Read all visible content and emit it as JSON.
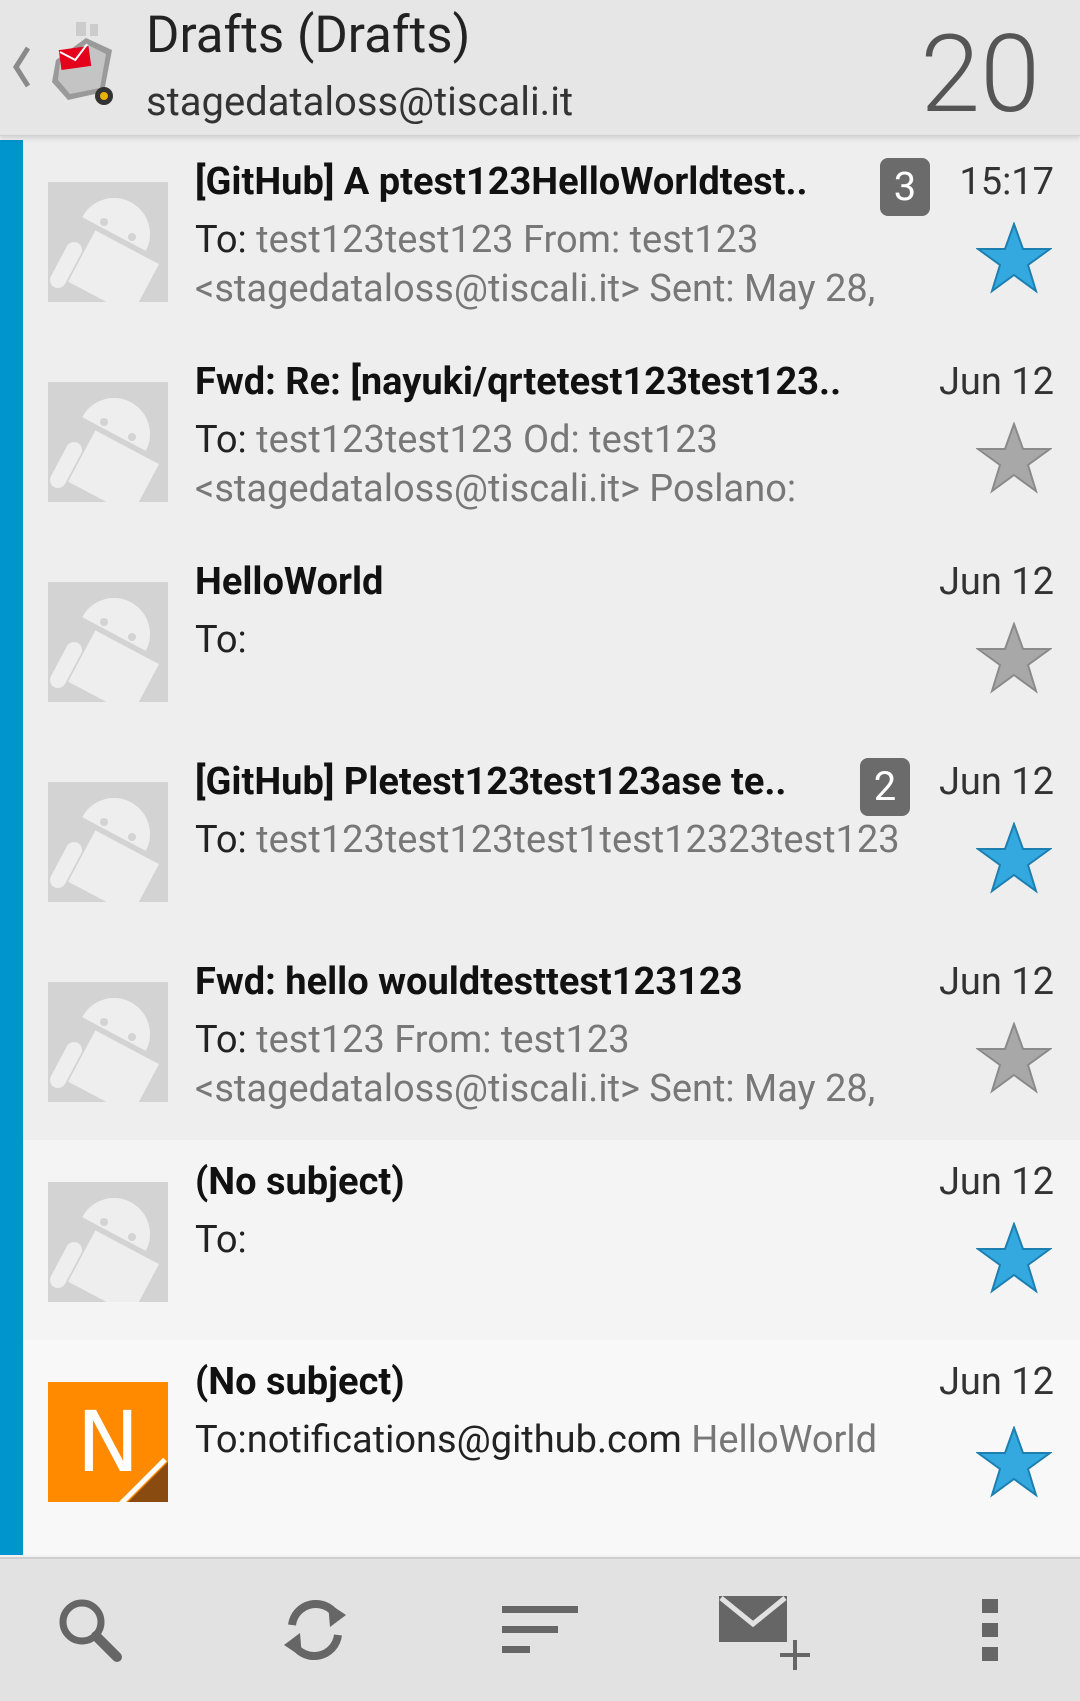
{
  "header": {
    "title": "Drafts (Drafts)",
    "account": "stagedataloss@tiscali.it",
    "count": "20"
  },
  "messages": [
    {
      "subject": "[GitHub] A ptest123HelloWorldtest..",
      "thread_count": "3",
      "date": "15:17",
      "to_label": "To:",
      "preview": " test123test123 From: test123 <stagedataloss@tiscali.it> Sent: May 28,",
      "starred": true,
      "avatar": "android-icon"
    },
    {
      "subject": "Fwd: Re: [nayuki/qrtetest123test123..",
      "thread_count": "",
      "date": "Jun 12",
      "to_label": "To:",
      "preview": " test123test123 Od: test123 <stagedataloss@tiscali.it> Poslano:",
      "starred": false,
      "avatar": "android-icon"
    },
    {
      "subject": "HelloWorld",
      "thread_count": "",
      "date": "Jun 12",
      "to_label": "To:",
      "preview": "",
      "starred": false,
      "avatar": "android-icon"
    },
    {
      "subject": "[GitHub] Pletest123test123ase te..",
      "thread_count": "2",
      "date": "Jun 12",
      "to_label": "To:",
      "preview": " test123test123test1test12323test123",
      "starred": true,
      "avatar": "android-icon"
    },
    {
      "subject": "Fwd: hello wouldtesttest123123",
      "thread_count": "",
      "date": "Jun 12",
      "to_label": "To:",
      "preview": " test123 From: test123 <stagedataloss@tiscali.it> Sent: May 28,",
      "starred": false,
      "avatar": "android-icon"
    },
    {
      "subject": "(No subject)",
      "thread_count": "",
      "date": "Jun 12",
      "to_label": "To:",
      "preview": "",
      "starred": true,
      "avatar": "android-icon"
    },
    {
      "subject": "(No subject)",
      "thread_count": "",
      "date": "Jun 12",
      "to_label": "To:notifications@github.com",
      "preview": " HelloWorld",
      "starred": true,
      "avatar": "letter-N",
      "avatar_letter": "N"
    }
  ],
  "toolbar": {
    "icons": [
      "search-icon",
      "refresh-icon",
      "sort-icon",
      "compose-icon",
      "overflow-menu-icon"
    ]
  },
  "colors": {
    "accent": "#0095cc",
    "star_on": "#33a9e0",
    "star_off": "#a8a8a8",
    "avatar_letter_bg": "#ff8a00"
  }
}
